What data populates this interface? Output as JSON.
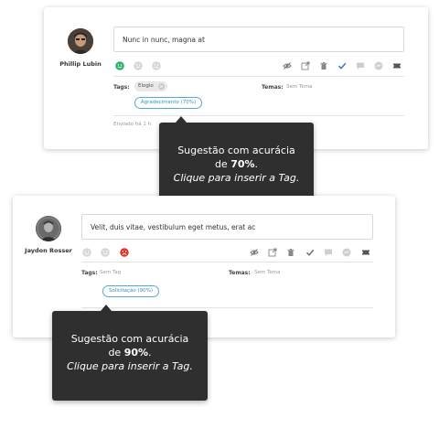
{
  "cards": [
    {
      "user": "Phillip Lubin",
      "message": "Nunc in nunc, magna at",
      "tags_label": "Tags:",
      "tag_chip": "Elogio",
      "temas_label": "Temas:",
      "temas_value": "Sem Tema",
      "suggestion": "Agradecimento (70%)",
      "sent": "Enviado há 1 h",
      "selected_emoji": "happy"
    },
    {
      "user": "Jaydon Rosser",
      "message": "Velit, duis vitae, vestibulum eget metus, erat ac",
      "tags_label": "Tags:",
      "tags_value": "Sem Tag",
      "temas_label": "Temas:",
      "temas_value": "Sem Tema",
      "suggestion": "Solicitação (90%)",
      "selected_emoji": "sad"
    }
  ],
  "tooltips": [
    {
      "line1": "Sugestão com acurácia",
      "line2_prefix": "de ",
      "percent": "70%",
      "line2_suffix": ".",
      "line3": "Clique para inserir a Tag."
    },
    {
      "line1": "Sugestão com acurácia",
      "line2_prefix": "de ",
      "percent": "90%",
      "line2_suffix": ".",
      "line3": "Clique para inserir a Tag."
    }
  ],
  "colors": {
    "happy": "#2fb36b",
    "sad": "#d93a2f",
    "check": "#3a6fd8",
    "suggestion_border": "#55a9d8",
    "tooltip_bg": "#2f2f2f"
  }
}
